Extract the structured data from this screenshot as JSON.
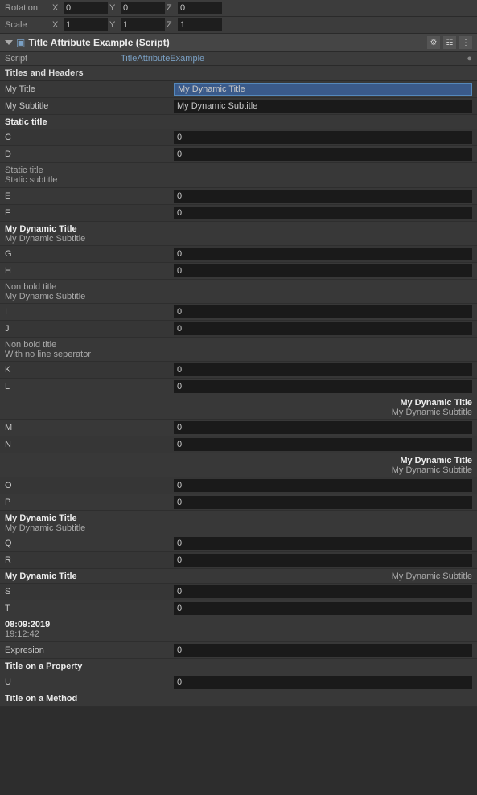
{
  "transform": {
    "rotation": {
      "label": "Rotation",
      "x": "0",
      "y": "0",
      "z": "0"
    },
    "scale": {
      "label": "Scale",
      "x": "1",
      "y": "1",
      "z": "1"
    }
  },
  "component": {
    "title": "Title Attribute Example (Script)",
    "script_label": "Script",
    "script_value": "TitleAttributeExample"
  },
  "sections": {
    "titles_and_headers": "Titles and Headers",
    "my_title_label": "My Title",
    "my_title_value": "My Dynamic Title",
    "my_subtitle_label": "My Subtitle",
    "my_subtitle_value": "My Dynamic Subtitle",
    "static_title_header": "Static title",
    "c_label": "C",
    "c_val": "0",
    "d_label": "D",
    "d_val": "0",
    "static_title2": "Static title",
    "static_subtitle2": "Static subtitle",
    "e_label": "E",
    "e_val": "0",
    "f_label": "F",
    "f_val": "0",
    "dyn_title1": "My Dynamic Title",
    "dyn_sub1": "My Dynamic Subtitle",
    "g_label": "G",
    "g_val": "0",
    "h_label": "H",
    "h_val": "0",
    "nonbold_title1": "Non bold title",
    "nonbold_sub1": "My Dynamic Subtitle",
    "i_label": "I",
    "i_val": "0",
    "j_label": "J",
    "j_val": "0",
    "nonbold_title2": "Non bold title",
    "nonbold_sub2": "With no line seperator",
    "k_label": "K",
    "k_val": "0",
    "l_label": "L",
    "l_val": "0",
    "right_title1": "My Dynamic Title",
    "right_sub1": "My Dynamic Subtitle",
    "m_label": "M",
    "m_val": "0",
    "n_label": "N",
    "n_val": "0",
    "center_title1": "My Dynamic Title",
    "center_sub1": "My Dynamic Subtitle",
    "o_label": "O",
    "o_val": "0",
    "p_label": "P",
    "p_val": "0",
    "dyn_title2": "My Dynamic Title",
    "dyn_sub2": "My Dynamic Subtitle",
    "q_label": "Q",
    "q_val": "0",
    "r_label": "R",
    "r_val": "0",
    "spread_title": "My Dynamic Title",
    "spread_sub": "My Dynamic Subtitle",
    "s_label": "S",
    "s_val": "0",
    "t_label": "T",
    "t_val": "0",
    "date_main": "08:09:2019",
    "date_sub": "19:12:42",
    "expresion_label": "Expresion",
    "expresion_val": "0",
    "title_on_property": "Title on a Property",
    "u_label": "U",
    "u_val": "0",
    "title_on_method": "Title on a Method"
  }
}
